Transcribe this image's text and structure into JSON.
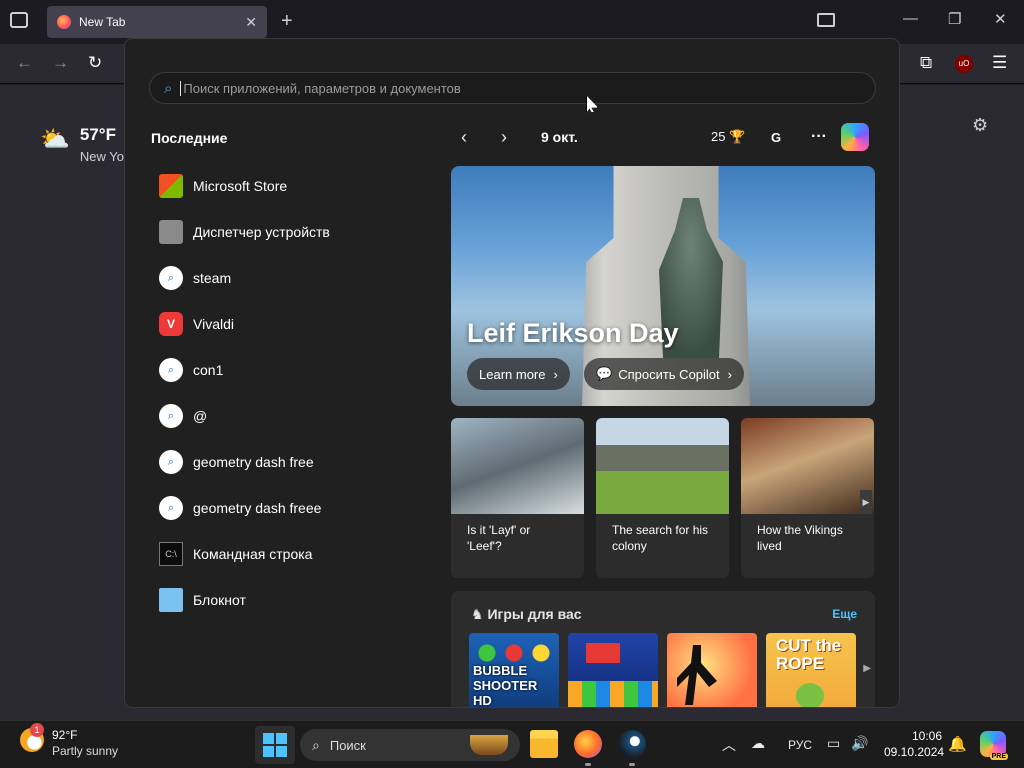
{
  "browser": {
    "tab_title": "New Tab",
    "tab_close": "✕",
    "new_tab_glyph": "+",
    "window_controls": [
      "—",
      "❐",
      "✕"
    ],
    "nav": {
      "back": "←",
      "forward": "→",
      "reload": "↻"
    },
    "extensions_glyph": "⧉",
    "ublock_label": "uO",
    "menu_glyph": "☰",
    "sidebar_glyph": "▭"
  },
  "newtab": {
    "weather_temp": "57°F",
    "weather_location": "New Yo",
    "settings_glyph": "⚙"
  },
  "start_menu": {
    "search_placeholder": "Поиск приложений, параметров и документов",
    "recent_title": "Последние",
    "recent_items": [
      {
        "label": "Microsoft Store",
        "icon": "store-icon"
      },
      {
        "label": "Диспетчер устройств",
        "icon": "device-manager-icon"
      },
      {
        "label": "steam",
        "icon": "search-icon"
      },
      {
        "label": "Vivaldi",
        "icon": "vivaldi-icon"
      },
      {
        "label": "con1",
        "icon": "search-icon"
      },
      {
        "label": "@",
        "icon": "search-icon"
      },
      {
        "label": "geometry dash free",
        "icon": "search-icon"
      },
      {
        "label": "geometry dash freee",
        "icon": "search-icon"
      },
      {
        "label": "Командная строка",
        "icon": "cmd-icon"
      },
      {
        "label": "Блокнот",
        "icon": "notepad-icon"
      }
    ]
  },
  "widgets": {
    "date": "9 окт.",
    "score": "25",
    "account_initial": "G",
    "more_glyph": "···",
    "hero_title": "Leif Erikson Day",
    "learn_more": "Learn more",
    "ask_copilot": "Спросить Copilot",
    "cards": [
      {
        "caption": "Is it 'Layf' or 'Leef'?"
      },
      {
        "caption": "The search for his colony"
      },
      {
        "caption": "How the Vikings lived"
      }
    ],
    "games_title": "Игры для вас",
    "games_more": "Еще",
    "games": [
      {
        "title": "BUBBLE SHOOTER HD"
      },
      {
        "title": ""
      },
      {
        "title": ""
      },
      {
        "title": "CUT the ROPE"
      }
    ]
  },
  "taskbar": {
    "weather_temp": "92°F",
    "weather_desc": "Partly sunny",
    "weather_badge": "1",
    "search_label": "Поиск",
    "lang": "РУС",
    "time": "10:06",
    "date": "09.10.2024",
    "copilot_badge": "PRE"
  }
}
